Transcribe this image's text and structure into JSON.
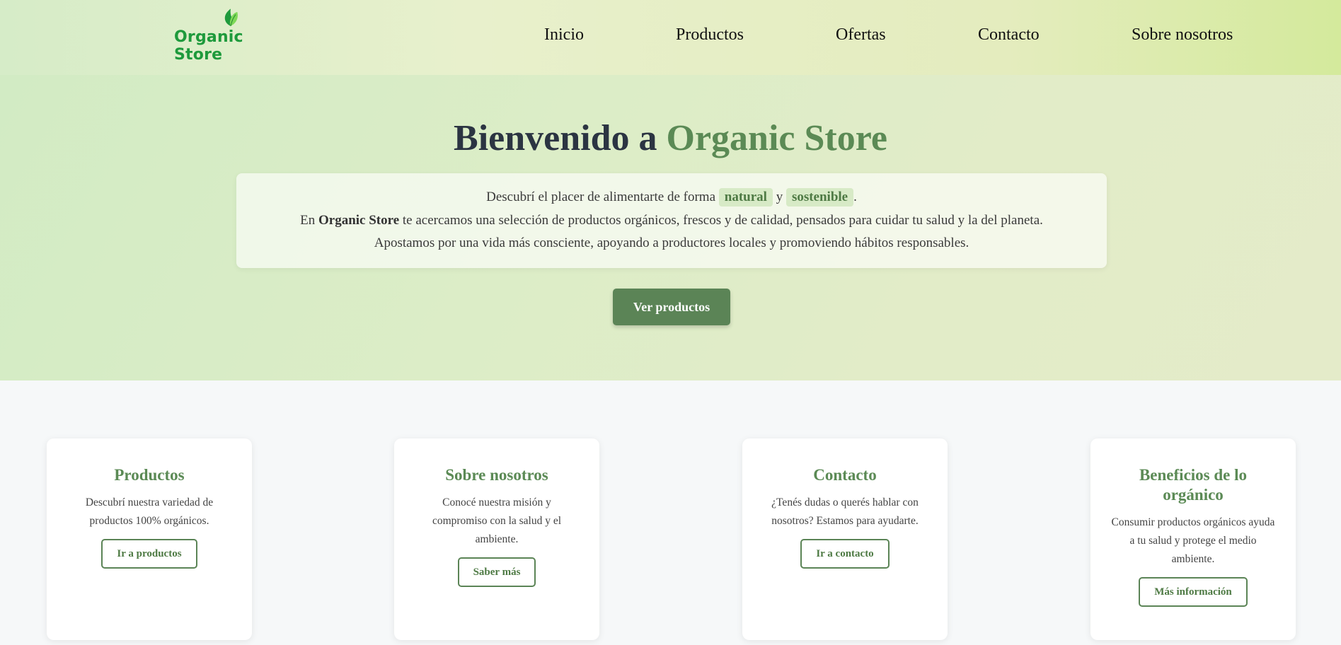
{
  "header": {
    "logo_text": "Organic Store",
    "logo_icon": "leaf-icon",
    "nav": [
      "Inicio",
      "Productos",
      "Ofertas",
      "Contacto",
      "Sobre nosotros"
    ]
  },
  "hero": {
    "title_prefix": "Bienvenido a ",
    "title_brand": "Organic Store",
    "line1_pre": "Descubrí el placer de alimentarte de forma ",
    "tag1": "natural",
    "line1_mid": " y ",
    "tag2": "sostenible",
    "line1_end": ".",
    "line2_pre": "En ",
    "line2_brand": "Organic Store",
    "line2_post": " te acercamos una selección de productos orgánicos, frescos y de calidad, pensados para cuidar tu salud y la del planeta.",
    "line3": "Apostamos por una vida más consciente, apoyando a productores locales y promoviendo hábitos responsables.",
    "cta": "Ver productos"
  },
  "cards": [
    {
      "title": "Productos",
      "text": "Descubrí nuestra variedad de productos 100% orgánicos.",
      "button": "Ir a productos"
    },
    {
      "title": "Sobre nosotros",
      "text": "Conocé nuestra misión y compromiso con la salud y el ambiente.",
      "button": "Saber más"
    },
    {
      "title": "Contacto",
      "text": "¿Tenés dudas o querés hablar con nosotros? Estamos para ayudarte.",
      "button": "Ir a contacto"
    },
    {
      "title": "Beneficios de lo orgánico",
      "text": "Consumir productos orgánicos ayuda a tu salud y protege el medio ambiente.",
      "button": "Más información"
    }
  ],
  "colors": {
    "brand_green": "#5b8a55",
    "logo_green": "#1e9a3c",
    "button_green": "#5b8456",
    "tag_bg": "#d7eac6"
  }
}
